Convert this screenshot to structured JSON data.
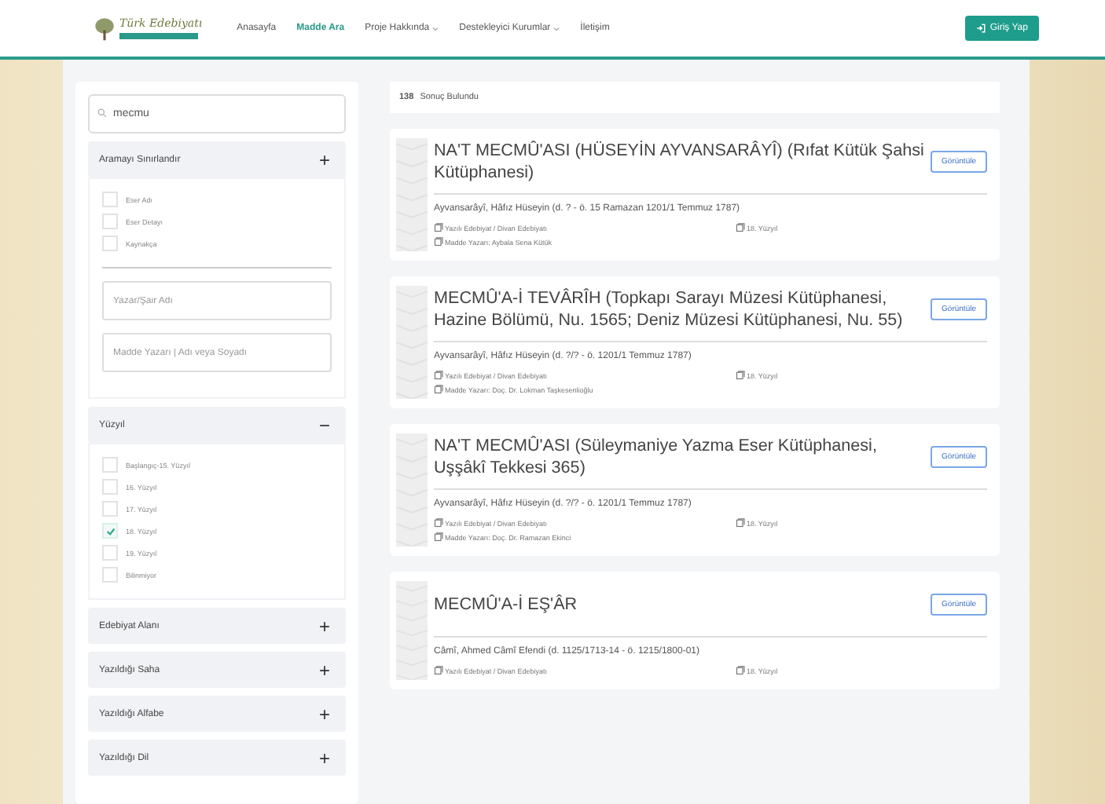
{
  "header": {
    "logo_text": "Türk Edebiyatı",
    "nav": [
      {
        "label": "Anasayfa",
        "selected": false,
        "dropdown": false
      },
      {
        "label": "Madde Ara",
        "selected": true,
        "dropdown": false
      },
      {
        "label": "Proje Hakkında",
        "selected": false,
        "dropdown": true
      },
      {
        "label": "Destekleyici Kurumlar",
        "selected": false,
        "dropdown": true
      },
      {
        "label": "İletişim",
        "selected": false,
        "dropdown": false
      }
    ],
    "login_button": "Giriş Yap"
  },
  "sidebar": {
    "search": {
      "value": "mecmu"
    },
    "sections": [
      {
        "title": "Aramayı Sınırlandır",
        "icon": "+",
        "expanded": true,
        "options": [
          {
            "label": "Eser Adı",
            "checked": false
          },
          {
            "label": "Eser Detayı",
            "checked": false
          },
          {
            "label": "Kaynakça",
            "checked": false
          }
        ],
        "fields": [
          {
            "placeholder": "Yazar/Şair Adı"
          },
          {
            "placeholder": "Madde Yazarı | Adı veya Soyadı"
          }
        ]
      },
      {
        "title": "Yüzyıl",
        "icon": "−",
        "expanded": true,
        "options": [
          {
            "label": "Başlangıç-15. Yüzyıl",
            "checked": false
          },
          {
            "label": "16. Yüzyıl",
            "checked": false
          },
          {
            "label": "17. Yüzyıl",
            "checked": false
          },
          {
            "label": "18. Yüzyıl",
            "checked": true
          },
          {
            "label": "19. Yüzyıl",
            "checked": false
          },
          {
            "label": "Bilinmiyor",
            "checked": false
          }
        ]
      },
      {
        "title": "Edebiyat Alanı",
        "icon": "+",
        "expanded": false
      },
      {
        "title": "Yazıldığı Saha",
        "icon": "+",
        "expanded": false
      },
      {
        "title": "Yazıldığı Alfabe",
        "icon": "+",
        "expanded": false
      },
      {
        "title": "Yazıldığı Dil",
        "icon": "+",
        "expanded": false
      }
    ]
  },
  "results": {
    "count": "138",
    "count_label": "Sonuç Bulundu",
    "items": [
      {
        "title": "NA'T MECMÛ'ASI (HÜSEYİN AYVANSARÂYÎ) (Rıfat Kütük Şahsi Kütüphanesi)",
        "button": "Görüntüle",
        "author": "Ayvansarâyî, Hâfız Hüseyin (d. ? - ö. 15 Ramazan 1201/1 Temmuz 1787)",
        "field": "Yazılı Edebiyat / Divan Edebiyatı",
        "century": "18. Yüzyıl",
        "writer": "Madde Yazarı: Aybala Sena Kütük"
      },
      {
        "title": "MECMÛ'A-İ TEVÂRÎH (Topkapı Sarayı Müzesi Kütüphanesi, Hazine Bölümü, Nu. 1565; Deniz Müzesi Kütüphanesi, Nu. 55)",
        "button": "Görüntüle",
        "author": "Ayvansarâyî, Hâfız Hüseyin (d. ?/? - ö. 1201/1 Temmuz 1787)",
        "field": "Yazılı Edebiyat / Divan Edebiyatı",
        "century": "18. Yüzyıl",
        "writer": "Madde Yazarı: Doç. Dr. Lokman Taşkesenlioğlu"
      },
      {
        "title": "NA'T MECMÛ'ASI (Süleymaniye Yazma Eser Kütüphanesi, Uşşâkî Tekkesi 365)",
        "button": "Görüntüle",
        "author": "Ayvansarâyî, Hâfız Hüseyin (d. ?/? - ö. 1201/1 Temmuz 1787)",
        "field": "Yazılı Edebiyat / Divan Edebiyatı",
        "century": "18. Yüzyıl",
        "writer": "Madde Yazarı: Doç. Dr. Ramazan Ekinci"
      },
      {
        "title": "MECMÛ'A-İ EŞ'ÂR",
        "button": "Görüntüle",
        "author": "Câmî, Ahmed Câmî Efendi (d. 1125/1713-14 - ö. 1215/1800-01)",
        "field": "Yazılı Edebiyat / Divan Edebiyatı",
        "century": "18. Yüzyıl"
      }
    ]
  }
}
